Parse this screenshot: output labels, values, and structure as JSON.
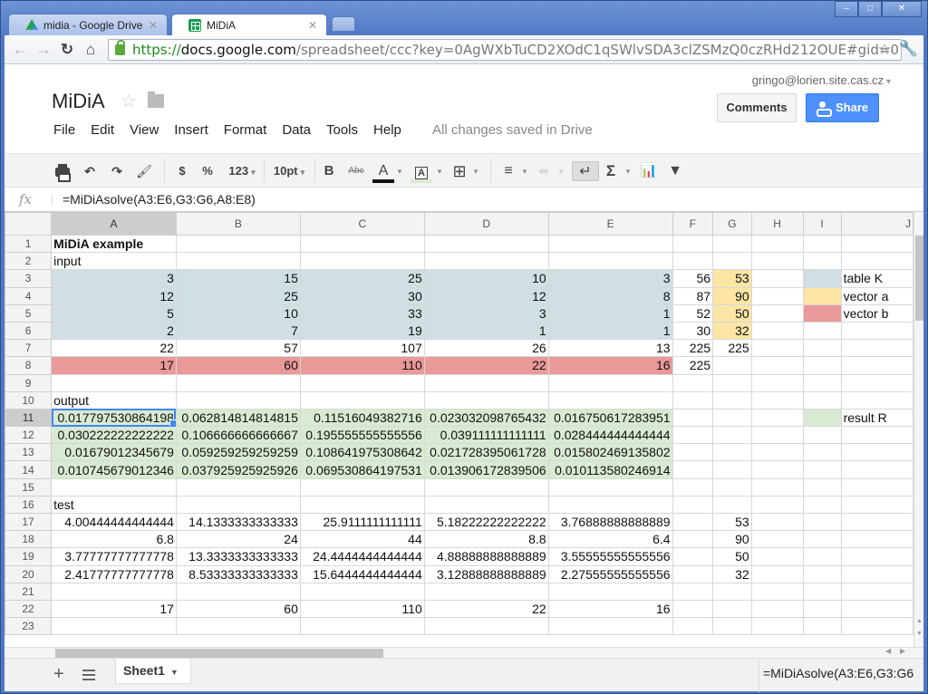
{
  "browser": {
    "tabs": [
      {
        "title": "midia - Google Drive",
        "icon": "google-drive-icon",
        "active": false
      },
      {
        "title": "MiDiA",
        "icon": "google-sheets-icon",
        "active": true
      }
    ],
    "url": {
      "scheme": "https://",
      "host": "docs.google.com",
      "path": "/spreadsheet/ccc?key=0AgWXbTuCD2XOdC1qSWlvSDA3clZSMzQ0czRHd212OUE#gid=0"
    },
    "window_controls": {
      "minimize": "–",
      "maximize": "□",
      "close": "✕"
    }
  },
  "doc": {
    "title": "MiDiA",
    "user_email": "gringo@lorien.site.cas.cz",
    "comments_label": "Comments",
    "share_label": "Share",
    "menu": [
      "File",
      "Edit",
      "View",
      "Insert",
      "Format",
      "Data",
      "Tools",
      "Help"
    ],
    "save_status": "All changes saved in Drive"
  },
  "toolbar": {
    "currency": "$",
    "percent": "%",
    "number_format": "123",
    "font_size": "10pt",
    "bold": "B",
    "strikethrough": "Abc",
    "text_color": "A",
    "fill_color": "A",
    "sum": "Σ"
  },
  "formula_bar": {
    "fx_label": "fx",
    "formula": "=MiDiAsolve(A3:E6,G3:G6,A8:E8)"
  },
  "sheet": {
    "columns": [
      "A",
      "B",
      "C",
      "D",
      "E",
      "F",
      "G",
      "H",
      "I",
      "J"
    ],
    "selected_column": "A",
    "selected_row": 11,
    "rows": [
      {
        "n": "1",
        "cells": [
          "MiDiA example",
          "",
          "",
          "",
          "",
          "",
          "",
          "",
          "",
          ""
        ]
      },
      {
        "n": "2",
        "cells": [
          "input",
          "",
          "",
          "",
          "",
          "",
          "",
          "",
          "",
          ""
        ]
      },
      {
        "n": "3",
        "cells": [
          "3",
          "15",
          "25",
          "10",
          "3",
          "56",
          "53",
          "",
          "",
          "table K"
        ]
      },
      {
        "n": "4",
        "cells": [
          "12",
          "25",
          "30",
          "12",
          "8",
          "87",
          "90",
          "",
          "",
          "vector a"
        ]
      },
      {
        "n": "5",
        "cells": [
          "5",
          "10",
          "33",
          "3",
          "1",
          "52",
          "50",
          "",
          "",
          "vector b"
        ]
      },
      {
        "n": "6",
        "cells": [
          "2",
          "7",
          "19",
          "1",
          "1",
          "30",
          "32",
          "",
          "",
          ""
        ]
      },
      {
        "n": "7",
        "cells": [
          "22",
          "57",
          "107",
          "26",
          "13",
          "225",
          "225",
          "",
          "",
          ""
        ]
      },
      {
        "n": "8",
        "cells": [
          "17",
          "60",
          "110",
          "22",
          "16",
          "225",
          "",
          "",
          "",
          ""
        ]
      },
      {
        "n": "9",
        "cells": [
          "",
          "",
          "",
          "",
          "",
          "",
          "",
          "",
          "",
          ""
        ]
      },
      {
        "n": "10",
        "cells": [
          "output",
          "",
          "",
          "",
          "",
          "",
          "",
          "",
          "",
          ""
        ]
      },
      {
        "n": "11",
        "cells": [
          "0.017797530864198",
          "0.062814814814815",
          "0.11516049382716",
          "0.023032098765432",
          "0.016750617283951",
          "",
          "",
          "",
          "",
          "result R"
        ]
      },
      {
        "n": "12",
        "cells": [
          "0.030222222222222",
          "0.106666666666667",
          "0.195555555555556",
          "0.039111111111111",
          "0.028444444444444",
          "",
          "",
          "",
          "",
          ""
        ]
      },
      {
        "n": "13",
        "cells": [
          "0.01679012345679",
          "0.059259259259259",
          "0.108641975308642",
          "0.021728395061728",
          "0.015802469135802",
          "",
          "",
          "",
          "",
          ""
        ]
      },
      {
        "n": "14",
        "cells": [
          "0.010745679012346",
          "0.037925925925926",
          "0.069530864197531",
          "0.013906172839506",
          "0.010113580246914",
          "",
          "",
          "",
          "",
          ""
        ]
      },
      {
        "n": "15",
        "cells": [
          "",
          "",
          "",
          "",
          "",
          "",
          "",
          "",
          "",
          ""
        ]
      },
      {
        "n": "16",
        "cells": [
          "test",
          "",
          "",
          "",
          "",
          "",
          "",
          "",
          "",
          ""
        ]
      },
      {
        "n": "17",
        "cells": [
          "4.00444444444444",
          "14.1333333333333",
          "25.9111111111111",
          "5.18222222222222",
          "3.76888888888889",
          "",
          "53",
          "",
          "",
          ""
        ]
      },
      {
        "n": "18",
        "cells": [
          "6.8",
          "24",
          "44",
          "8.8",
          "6.4",
          "",
          "90",
          "",
          "",
          ""
        ]
      },
      {
        "n": "19",
        "cells": [
          "3.77777777777778",
          "13.3333333333333",
          "24.4444444444444",
          "4.88888888888889",
          "3.55555555555556",
          "",
          "50",
          "",
          "",
          ""
        ]
      },
      {
        "n": "20",
        "cells": [
          "2.41777777777778",
          "8.53333333333333",
          "15.6444444444444",
          "3.12888888888889",
          "2.27555555555556",
          "",
          "32",
          "",
          "",
          ""
        ]
      },
      {
        "n": "21",
        "cells": [
          "",
          "",
          "",
          "",
          "",
          "",
          "",
          "",
          "",
          ""
        ]
      },
      {
        "n": "22",
        "cells": [
          "17",
          "60",
          "110",
          "22",
          "16",
          "",
          "",
          "",
          "",
          ""
        ]
      },
      {
        "n": "23",
        "cells": [
          "",
          "",
          "",
          "",
          "",
          "",
          "",
          "",
          "",
          ""
        ]
      }
    ],
    "fills": {
      "table_K": "#d0dfe3",
      "vector_a": "#fce5a5",
      "vector_b": "#ea9999",
      "result_R": "#d9ead3"
    }
  },
  "bottom": {
    "add_sheet": "+",
    "sheet_tab": "Sheet1",
    "status_formula": "=MiDiAsolve(A3:E6,G3:G6"
  }
}
